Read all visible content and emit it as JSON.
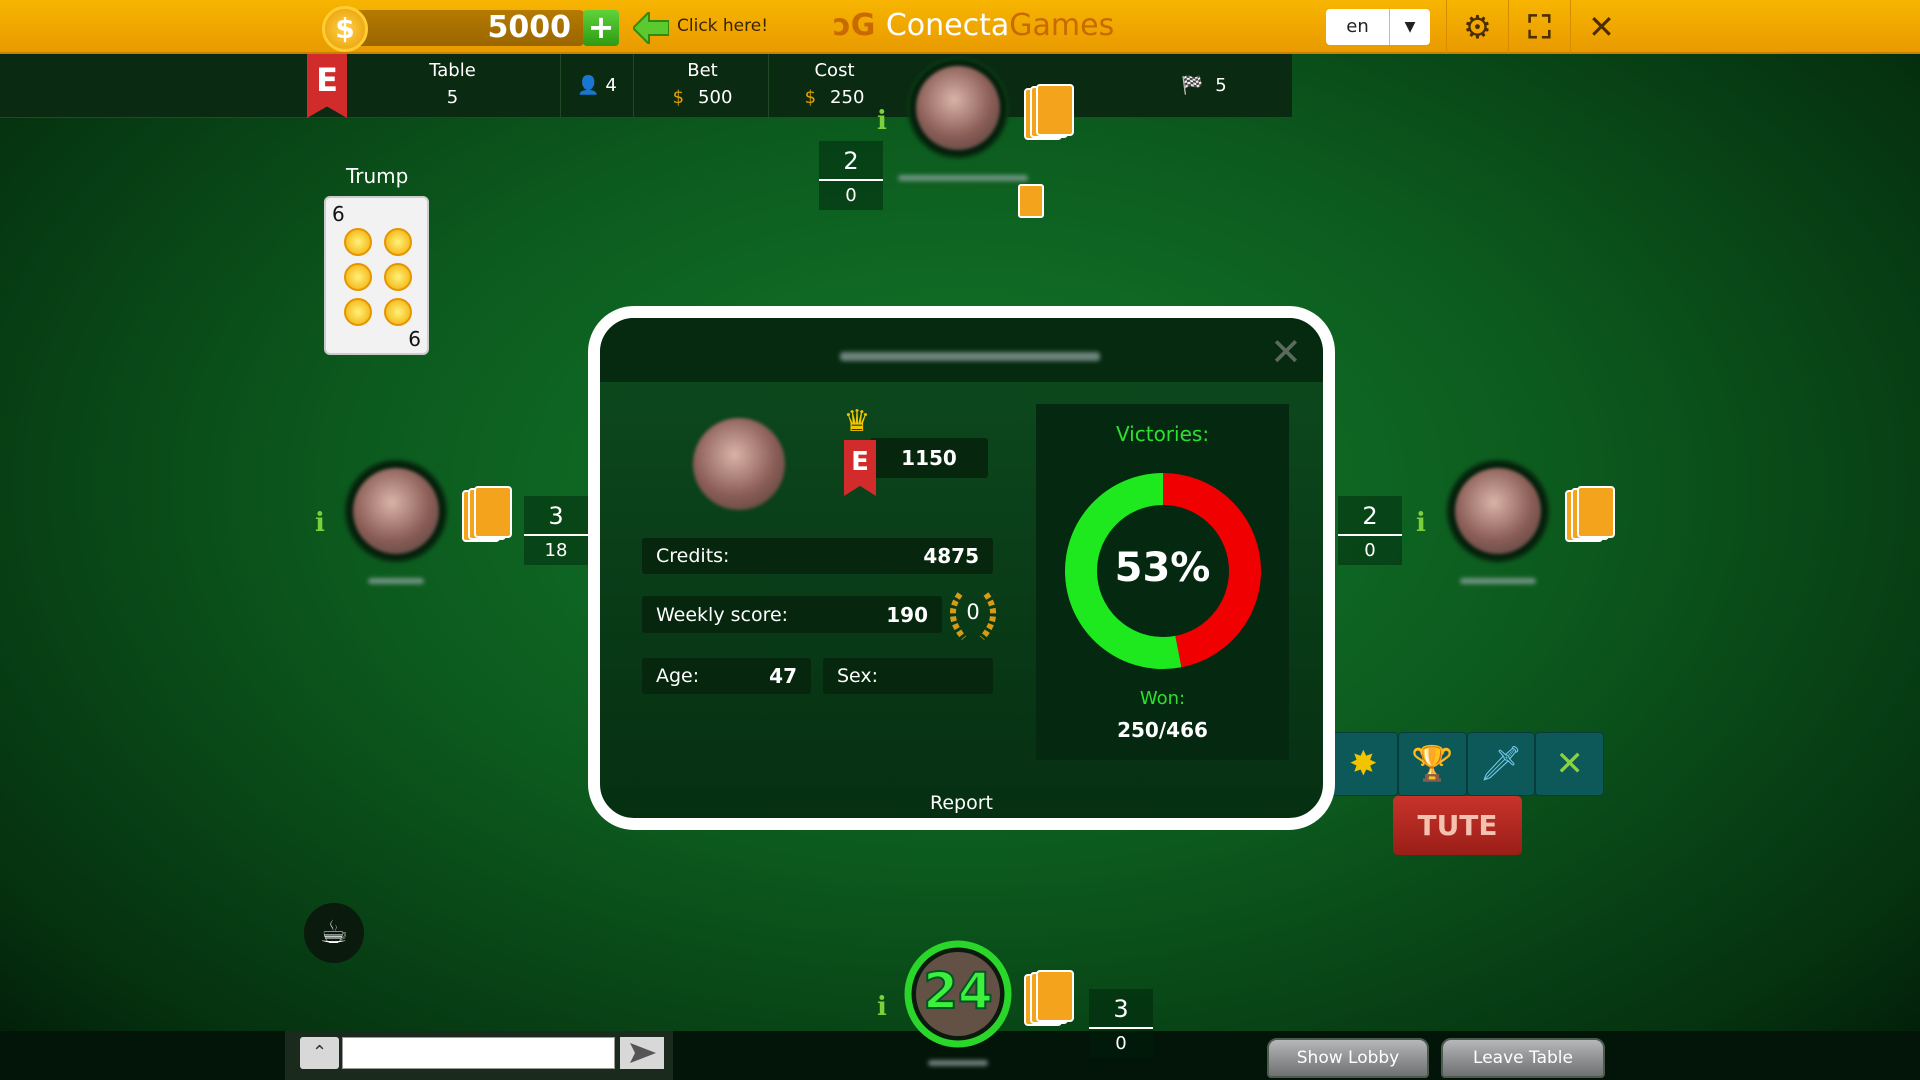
{
  "topbar": {
    "credits": "5000",
    "add_label": "+",
    "click_here": "Click here!",
    "logo_a": "Conecta",
    "logo_b": "Games",
    "language": "en",
    "icons": [
      "gear-icon",
      "fullscreen-icon",
      "close-icon"
    ]
  },
  "infobar": {
    "rank_letter": "E",
    "table_label": "Table",
    "table_value": "5",
    "players": "4",
    "bet_label": "Bet",
    "bet_value": "500",
    "cost_label": "Cost",
    "cost_value": "250",
    "currency": "$",
    "rounds": "5"
  },
  "trump": {
    "label": "Trump",
    "rank": "6",
    "suit": "oros"
  },
  "players": {
    "top": {
      "score": "2",
      "sub": "0"
    },
    "left": {
      "score": "3",
      "sub": "18"
    },
    "right": {
      "score": "2",
      "sub": "0"
    },
    "bottom": {
      "score": "3",
      "sub": "0",
      "timer": "24"
    }
  },
  "modal": {
    "rank_letter": "E",
    "rank_points": "1150",
    "credits_label": "Credits:",
    "credits_value": "4875",
    "weekly_label": "Weekly score:",
    "weekly_value": "190",
    "laurel_value": "0",
    "age_label": "Age:",
    "age_value": "47",
    "sex_label": "Sex:",
    "sex_value": "",
    "victories_label": "Victories:",
    "win_percent": 53,
    "win_percent_text": "53%",
    "won_label": "Won:",
    "won_value": "250/466",
    "report_label": "Report",
    "colors": {
      "win": "#1ee81e",
      "loss": "#f00000"
    }
  },
  "suits": [
    "oros",
    "copas",
    "espadas",
    "bastos"
  ],
  "tute_label": "TUTE",
  "bottom": {
    "show_lobby": "Show Lobby",
    "leave_table": "Leave Table",
    "chat_placeholder": ""
  }
}
